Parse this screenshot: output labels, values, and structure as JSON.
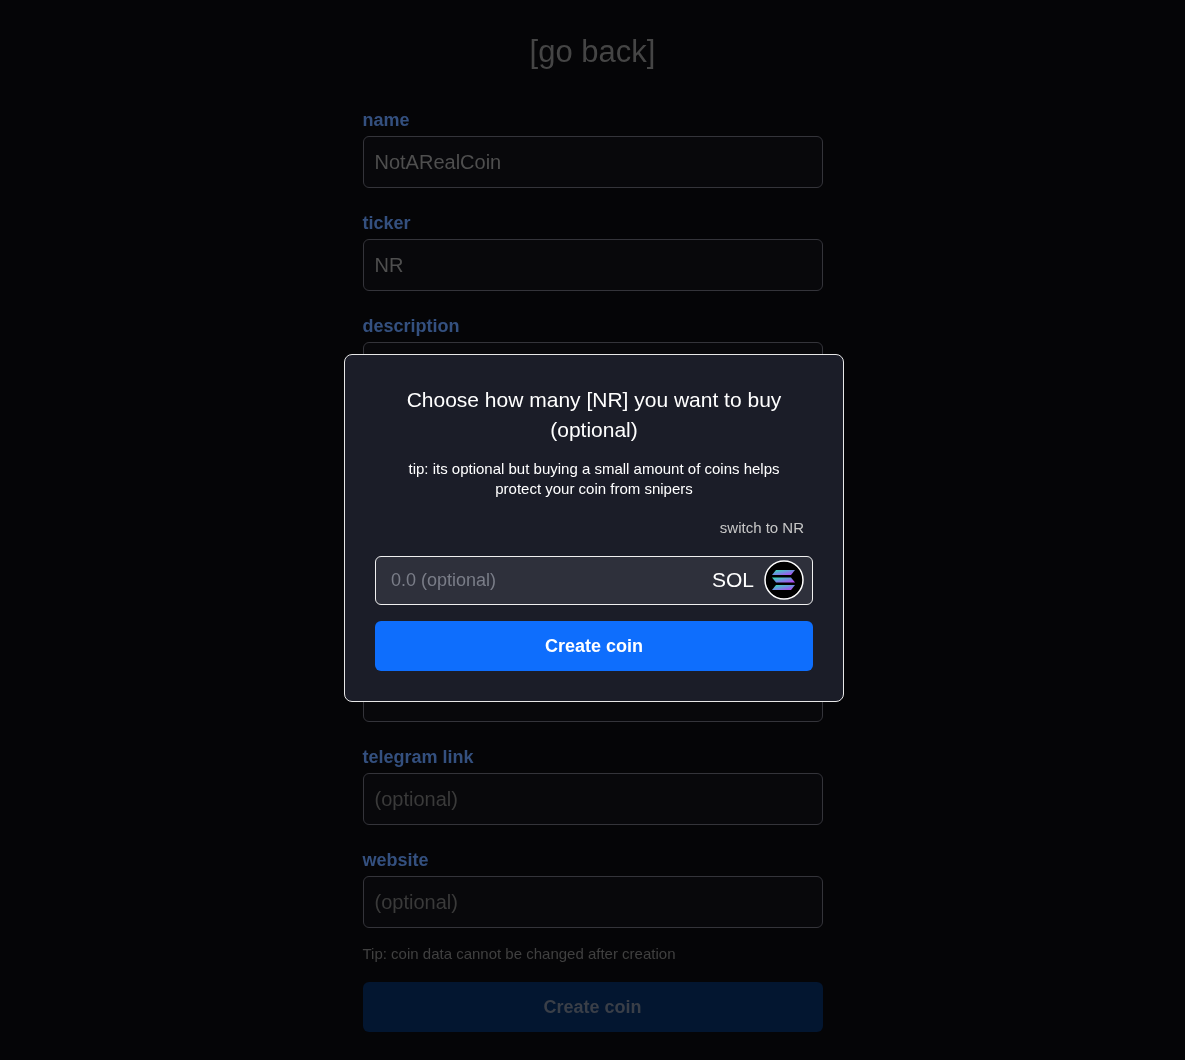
{
  "back_link": "[go back]",
  "form": {
    "fields": [
      {
        "kind": "input",
        "label": "name",
        "value": "NotARealCoin"
      },
      {
        "kind": "input",
        "label": "ticker",
        "value": "NR"
      },
      {
        "kind": "textarea",
        "label": "description"
      },
      {
        "kind": "input",
        "label": "telegram link",
        "placeholder": "(optional)"
      },
      {
        "kind": "input",
        "label": "website",
        "placeholder": "(optional)"
      }
    ],
    "tip": "Tip: coin data cannot be changed after creation",
    "submit_button": "Create coin"
  },
  "modal": {
    "title": "Choose how many [NR] you want to buy (optional)",
    "tip": "tip: its optional but buying a small amount of coins helps protect your coin from snipers",
    "switch_link": "switch to NR",
    "amount_field": {
      "placeholder": "0.0 (optional)",
      "currency": "SOL"
    },
    "submit_button": "Create coin"
  }
}
